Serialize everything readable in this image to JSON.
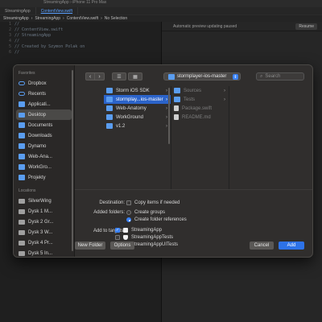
{
  "xcode": {
    "window_title": "StreamingApp  ›  iPhone 11 Pro Max",
    "tabs": [
      {
        "label": "StreamingApp"
      },
      {
        "label": "ContentView.swift"
      }
    ],
    "breadcrumbs": [
      "StreamingApp",
      "StreamingApp",
      "ContentView.swift",
      "No Selection"
    ],
    "code_lines": [
      {
        "n": "1",
        "text": "//"
      },
      {
        "n": "2",
        "text": "//  ContentView.swift"
      },
      {
        "n": "3",
        "text": "//  StreamingApp"
      },
      {
        "n": "4",
        "text": "//"
      },
      {
        "n": "5",
        "text": "//  Created by Szymon Polak on"
      },
      {
        "n": "6",
        "text": "//"
      }
    ],
    "canvas_status": "Automatic preview updating paused",
    "resume_label": "Resume"
  },
  "sidebar": {
    "favorites_label": "Favorites",
    "favorites": [
      {
        "label": "Dropbox",
        "icon": "dropbox-icon"
      },
      {
        "label": "Recents",
        "icon": "recents-icon"
      },
      {
        "label": "Applicati...",
        "icon": "applications-icon"
      },
      {
        "label": "Desktop",
        "icon": "desktop-icon",
        "selected": true
      },
      {
        "label": "Documents",
        "icon": "documents-icon"
      },
      {
        "label": "Downloads",
        "icon": "downloads-icon"
      },
      {
        "label": "Dynamo",
        "icon": "folder-icon"
      },
      {
        "label": "Web-Ana...",
        "icon": "folder-icon"
      },
      {
        "label": "WorkGro...",
        "icon": "folder-icon"
      },
      {
        "label": "Projekty",
        "icon": "folder-icon"
      }
    ],
    "locations_label": "Locations",
    "locations": [
      {
        "label": "SilverWing",
        "icon": "computer-icon"
      },
      {
        "label": "Dysk 1 M...",
        "icon": "drive-icon"
      },
      {
        "label": "Dysk 2 Gr...",
        "icon": "drive-icon"
      },
      {
        "label": "Dysk 3 W...",
        "icon": "drive-icon"
      },
      {
        "label": "Dysk 4 Pr...",
        "icon": "drive-icon"
      },
      {
        "label": "Dysk 5 In...",
        "icon": "drive-icon"
      }
    ]
  },
  "toolbar": {
    "back": "‹",
    "forward": "›",
    "view_columns": "☰",
    "view_grid": "▦",
    "path_label": "stormplayer-ios-master",
    "search_placeholder": "Search"
  },
  "browser": {
    "column1": [
      {
        "label": "Storm iOS SDK",
        "arrow": true
      },
      {
        "label": "stormplay...ios-master",
        "arrow": true,
        "selected": true
      },
      {
        "label": "Web-Anatomy",
        "arrow": true
      },
      {
        "label": "WorkGround",
        "arrow": true
      },
      {
        "label": "v1.2",
        "arrow": true
      }
    ],
    "column2": [
      {
        "label": "Sources",
        "arrow": true,
        "dim": true
      },
      {
        "label": "Tests",
        "arrow": true,
        "dim": true
      },
      {
        "label": "Package.swift",
        "dim": true,
        "file": true
      },
      {
        "label": "README.md",
        "dim": true,
        "file": true
      }
    ]
  },
  "options": {
    "destination_label": "Destination:",
    "destination_value": "Copy items if needed",
    "added_folders_label": "Added folders:",
    "create_groups": "Create groups",
    "create_folder_refs": "Create folder references",
    "add_to_targets_label": "Add to targets:",
    "targets": [
      {
        "label": "StreamingApp",
        "checked": true,
        "kind": "app"
      },
      {
        "label": "StreamingAppTests",
        "checked": false,
        "kind": "test"
      },
      {
        "label": "StreamingAppUITests",
        "checked": false,
        "kind": "test"
      }
    ]
  },
  "footer": {
    "new_folder": "New Folder",
    "options": "Options",
    "cancel": "Cancel",
    "add": "Add"
  },
  "colors": {
    "accent": "#2d72e8",
    "selection": "#2b63c9",
    "sheet_bg": "#302e2d",
    "folder": "#5a9df0"
  }
}
